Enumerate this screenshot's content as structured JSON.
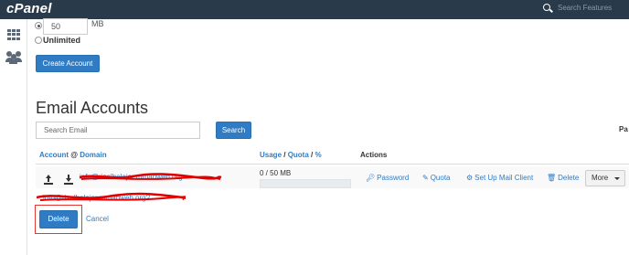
{
  "app": {
    "logo": "cPanel",
    "search_placeholder": "Search Features"
  },
  "quota": {
    "value": "50",
    "unit": "MB",
    "unlimited_label": "Unlimited"
  },
  "create_button": "Create Account",
  "section": {
    "title": "Email Accounts",
    "search_placeholder": "Search Email",
    "search_button": "Search",
    "edge_label": "Pa"
  },
  "table": {
    "headers": {
      "account": "Account",
      "at": " @ ",
      "domain": "Domain",
      "usage": "Usage",
      "quota": "Quota",
      "percent": "%",
      "actions": "Actions"
    },
    "row": {
      "email": "info@rizalbelajar.rumahweb.org",
      "email_second": "info@rizalbelajar.rumahweb.org?",
      "usage": "0 / 50 MB",
      "usage_fraction": 0
    }
  },
  "actions": {
    "password": "Password",
    "quota": "Quota",
    "mail_client": "Set Up Mail Client",
    "delete": "Delete",
    "more": "More"
  },
  "confirm": {
    "delete": "Delete",
    "cancel": "Cancel"
  },
  "colors": {
    "topbar": "#293a4a",
    "accent": "#2f7cc4",
    "highlight": "#e53935",
    "redaction": "#e00000"
  }
}
